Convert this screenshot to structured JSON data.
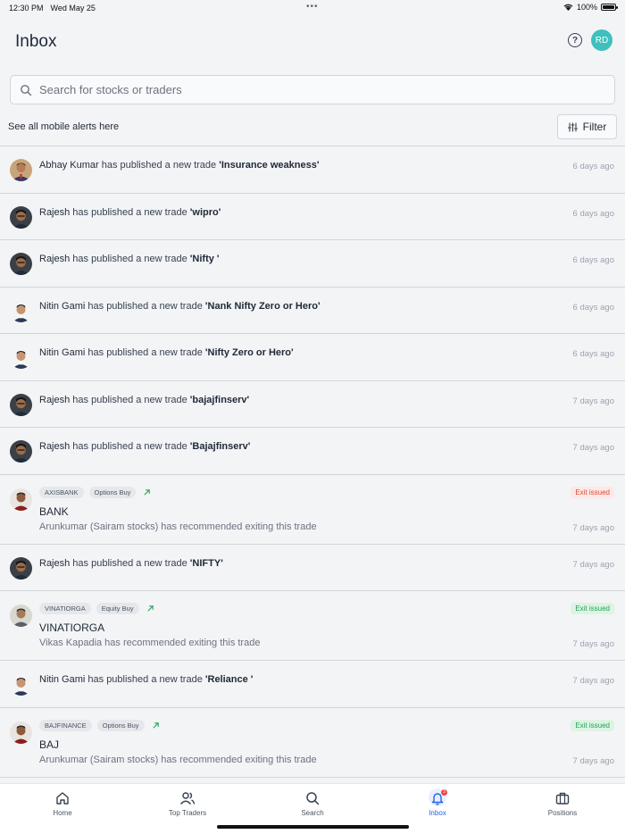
{
  "status": {
    "time": "12:30 PM",
    "date": "Wed May 25",
    "battery": "100%"
  },
  "header": {
    "title": "Inbox",
    "help_icon": "?",
    "avatar_initials": "RD"
  },
  "search": {
    "placeholder": "Search for stocks or traders"
  },
  "subbar": {
    "text": "See all mobile alerts here",
    "filter_label": "Filter"
  },
  "colors": {
    "accent": "#2563eb",
    "avatar_bg": "#3fc0bd",
    "exit_red": "#dc4a3a",
    "exit_green": "#22a356"
  },
  "notifications": [
    {
      "name": "Abhay Kumar",
      "mid": " has published a new trade ",
      "trade": "'Insurance weakness'",
      "time": "6 days ago",
      "avatar": "abhay"
    },
    {
      "name": "Rajesh",
      "mid": " has published a new trade ",
      "trade": "'wipro'",
      "time": "6 days ago",
      "avatar": "rajesh"
    },
    {
      "name": "Rajesh",
      "mid": " has published a new trade ",
      "trade": "'Nifty '",
      "time": "6 days ago",
      "avatar": "rajesh"
    },
    {
      "name": "Nitin Gami",
      "mid": " has published a new trade ",
      "trade": "'Nank Nifty Zero or Hero'",
      "time": "6 days ago",
      "avatar": "nitin"
    },
    {
      "name": "Nitin Gami",
      "mid": " has published a new trade ",
      "trade": "'Nifty Zero or Hero'",
      "time": "6 days ago",
      "avatar": "nitin"
    },
    {
      "name": "Rajesh",
      "mid": " has published a new trade ",
      "trade": "'bajajfinserv'",
      "time": "7 days ago",
      "avatar": "rajesh"
    },
    {
      "name": "Rajesh",
      "mid": " has published a new trade ",
      "trade": "'Bajajfinserv'",
      "time": "7 days ago",
      "avatar": "rajesh"
    }
  ],
  "rec1": {
    "chip1": "AXISBANK",
    "chip2": "Options Buy",
    "badge": "Exit issued",
    "symbol": "BANK",
    "text": "Arunkumar (Sairam stocks) has recommended exiting this trade",
    "time": "7 days ago"
  },
  "notif8": {
    "name": "Rajesh",
    "mid": " has published a new trade ",
    "trade": "'NIFTY'",
    "time": "7 days ago"
  },
  "rec2": {
    "chip1": "VINATIORGA",
    "chip2": "Equity Buy",
    "badge": "Exit issued",
    "symbol": "VINATIORGA",
    "text": "Vikas Kapadia has recommended exiting this trade",
    "time": "7 days ago"
  },
  "notif9": {
    "name": "Nitin Gami",
    "mid": " has published a new trade ",
    "trade": "'Reliance '",
    "time": "7 days ago"
  },
  "rec3": {
    "chip1": "BAJFINANCE",
    "chip2": "Options Buy",
    "badge": "Exit issued",
    "symbol": "BAJ",
    "text": "Arunkumar (Sairam stocks) has recommended exiting this trade",
    "time": "7 days ago"
  },
  "tabs": {
    "home": "Home",
    "traders": "Top Traders",
    "search": "Search",
    "inbox": "Inbox",
    "positions": "Positions",
    "inbox_badge": "3"
  }
}
